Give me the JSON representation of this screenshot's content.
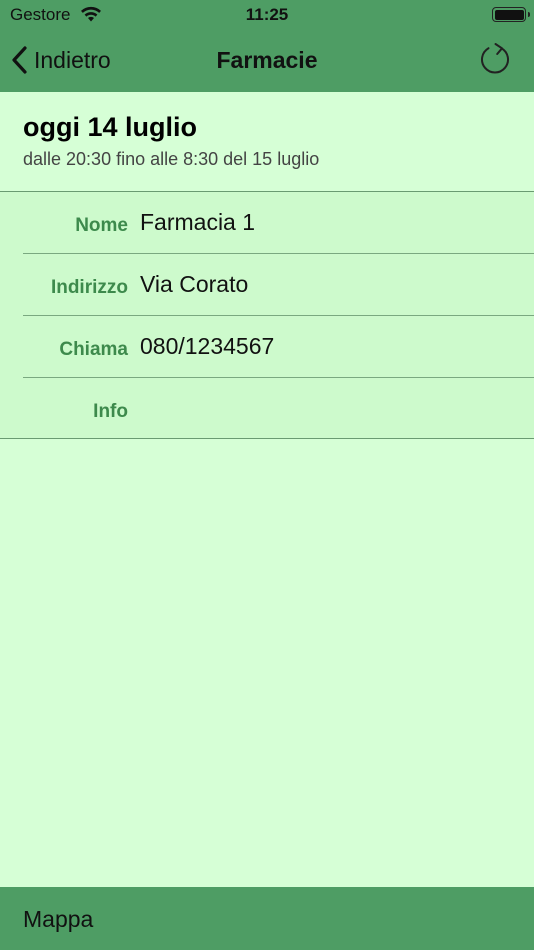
{
  "status_bar": {
    "carrier": "Gestore",
    "time": "11:25",
    "icons": [
      "wifi-icon",
      "battery-icon"
    ]
  },
  "navbar": {
    "back_label": "Indietro",
    "title": "Farmacie",
    "icons": [
      "chevron-left-icon",
      "refresh-icon"
    ]
  },
  "header": {
    "title": "oggi 14 luglio",
    "subtitle": "dalle 20:30 fino alle 8:30 del 15 luglio"
  },
  "details": {
    "rows": [
      {
        "label": "Nome",
        "value": "Farmacia 1"
      },
      {
        "label": "Indirizzo",
        "value": "Via Corato"
      },
      {
        "label": "Chiama",
        "value": "080/1234567"
      },
      {
        "label": "Info",
        "value": ""
      }
    ]
  },
  "bottom_bar": {
    "map_label": "Mappa"
  },
  "colors": {
    "bar_green": "#4e9d64",
    "background": "#d6ffd6",
    "rows_background": "#cdfacc",
    "label_green": "#3d8a4c"
  }
}
